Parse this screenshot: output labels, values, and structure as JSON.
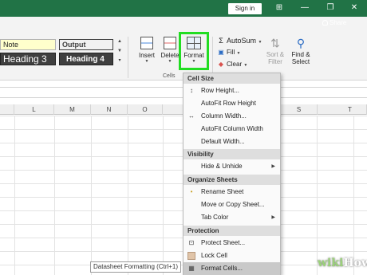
{
  "titlebar": {
    "signin_label": "Sign in",
    "window_buttons": [
      "⊞",
      "—",
      "❐",
      "✕"
    ],
    "share_label": "Share"
  },
  "ribbon": {
    "styles": {
      "note": "Note",
      "output": "Output",
      "heading3": "Heading 3",
      "heading4": "Heading 4"
    },
    "cells_group": {
      "insert_label": "Insert",
      "delete_label": "Delete",
      "format_label": "Format",
      "group_label": "Cells"
    },
    "editing_group": {
      "autosum_label": "AutoSum",
      "fill_label": "Fill",
      "clear_label": "Clear",
      "sort_label": "Sort &",
      "sort_label2": "Filter",
      "find_label": "Find &",
      "find_label2": "Select"
    },
    "highlight_color": "#22dd22"
  },
  "grid": {
    "columns": [
      "L",
      "M",
      "N",
      "O",
      "S",
      "T"
    ]
  },
  "format_menu": {
    "sections": {
      "cell_size": "Cell Size",
      "visibility": "Visibility",
      "organize": "Organize Sheets",
      "protection": "Protection"
    },
    "items": {
      "row_height": "Row Height...",
      "autofit_row": "AutoFit Row Height",
      "column_width": "Column Width...",
      "autofit_column": "AutoFit Column Width",
      "default_width": "Default Width...",
      "hide_unhide": "Hide & Unhide",
      "rename_sheet": "Rename Sheet",
      "move_copy": "Move or Copy Sheet...",
      "tab_color": "Tab Color",
      "protect_sheet": "Protect Sheet...",
      "lock_cell": "Lock Cell",
      "format_cells": "Format Cells..."
    }
  },
  "tooltip": {
    "text": "Datasheet Formatting (Ctrl+1)"
  },
  "watermark": {
    "part1": "wiki",
    "part2": "How"
  }
}
